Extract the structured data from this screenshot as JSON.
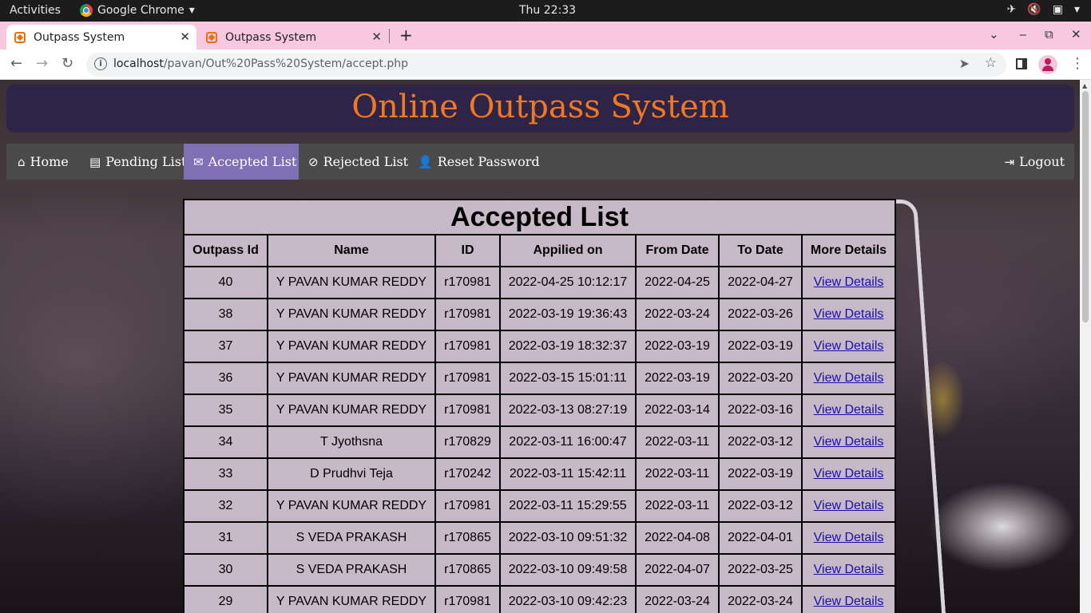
{
  "os": {
    "activities": "Activities",
    "app_name": "Google Chrome",
    "clock": "Thu 22:33"
  },
  "browser": {
    "tabs": [
      {
        "label": "Outpass System",
        "active": true
      },
      {
        "label": "Outpass System",
        "active": false
      }
    ],
    "url_host": "localhost",
    "url_path": "/pavan/Out%20Pass%20System/accept.php"
  },
  "site": {
    "title": "Online Outpass System",
    "nav": [
      {
        "icon": "home-icon",
        "label": "Home"
      },
      {
        "icon": "book-icon",
        "label": "Pending List"
      },
      {
        "icon": "envelope-icon",
        "label": "Accepted List"
      },
      {
        "icon": "ban-icon",
        "label": "Rejected List"
      },
      {
        "icon": "user-icon",
        "label": "Reset Password"
      }
    ],
    "logout": "Logout",
    "active_nav": "Accepted List"
  },
  "table": {
    "title": "Accepted List",
    "columns": [
      "Outpass Id",
      "Name",
      "ID",
      "Appilied on",
      "From Date",
      "To Date",
      "More Details"
    ],
    "link_label": "View Details",
    "rows": [
      [
        "40",
        "Y PAVAN KUMAR REDDY",
        "r170981",
        "2022-04-25 10:12:17",
        "2022-04-25",
        "2022-04-27"
      ],
      [
        "38",
        "Y PAVAN KUMAR REDDY",
        "r170981",
        "2022-03-19 19:36:43",
        "2022-03-24",
        "2022-03-26"
      ],
      [
        "37",
        "Y PAVAN KUMAR REDDY",
        "r170981",
        "2022-03-19 18:32:37",
        "2022-03-19",
        "2022-03-19"
      ],
      [
        "36",
        "Y PAVAN KUMAR REDDY",
        "r170981",
        "2022-03-15 15:01:11",
        "2022-03-19",
        "2022-03-20"
      ],
      [
        "35",
        "Y PAVAN KUMAR REDDY",
        "r170981",
        "2022-03-13 08:27:19",
        "2022-03-14",
        "2022-03-16"
      ],
      [
        "34",
        "T Jyothsna",
        "r170829",
        "2022-03-11 16:00:47",
        "2022-03-11",
        "2022-03-12"
      ],
      [
        "33",
        "D Prudhvi Teja",
        "r170242",
        "2022-03-11 15:42:11",
        "2022-03-11",
        "2022-03-19"
      ],
      [
        "32",
        "Y PAVAN KUMAR REDDY",
        "r170981",
        "2022-03-11 15:29:55",
        "2022-03-11",
        "2022-03-12"
      ],
      [
        "31",
        "S VEDA PRAKASH",
        "r170865",
        "2022-03-10 09:51:32",
        "2022-04-08",
        "2022-04-01"
      ],
      [
        "30",
        "S VEDA PRAKASH",
        "r170865",
        "2022-03-10 09:49:58",
        "2022-04-07",
        "2022-03-25"
      ],
      [
        "29",
        "Y PAVAN KUMAR REDDY",
        "r170981",
        "2022-03-10 09:42:23",
        "2022-03-24",
        "2022-03-24"
      ]
    ]
  }
}
